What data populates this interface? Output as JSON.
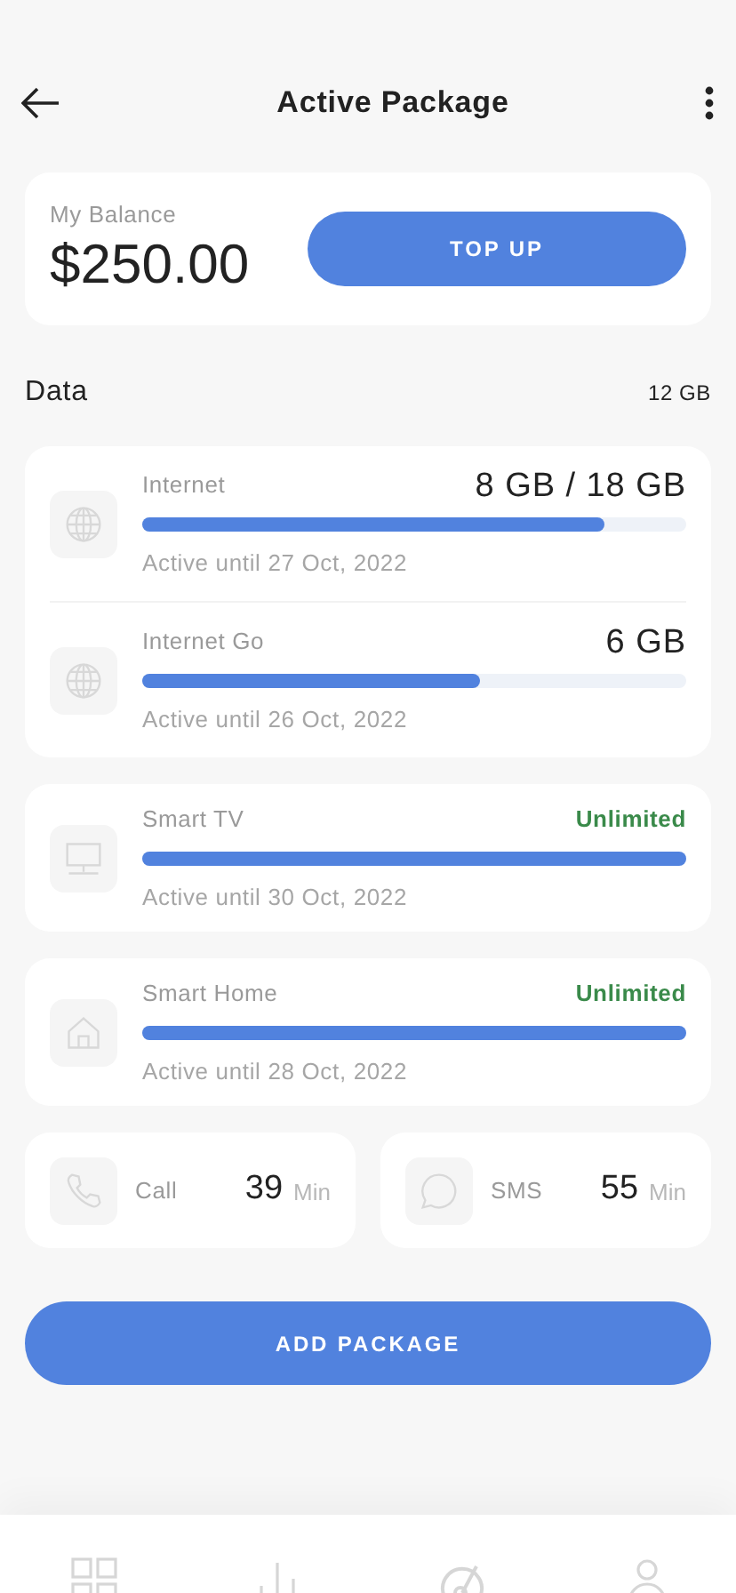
{
  "header": {
    "title": "Active Package"
  },
  "balance": {
    "label": "My Balance",
    "amount": "$250.00",
    "button": "TOP UP"
  },
  "data_section": {
    "title": "Data",
    "total": "12 GB"
  },
  "data_cards": [
    {
      "items": [
        {
          "kind": "internet",
          "name": "Internet",
          "amount": "8 GB / 18 GB",
          "unlimited": false,
          "level": 0.85,
          "expiry": "Active until 27 Oct, 2022"
        },
        {
          "kind": "internet",
          "name": "Internet Go",
          "amount": "6 GB",
          "unlimited": false,
          "level": 0.62,
          "expiry": "Active until 26 Oct, 2022"
        }
      ]
    },
    {
      "items": [
        {
          "kind": "tv",
          "name": "Smart TV",
          "amount": "Unlimited",
          "unlimited": true,
          "level": 1,
          "expiry": "Active until 30 Oct, 2022"
        }
      ]
    },
    {
      "items": [
        {
          "kind": "home",
          "name": "Smart Home",
          "amount": "Unlimited",
          "unlimited": true,
          "level": 1,
          "expiry": "Active until 28 Oct, 2022"
        }
      ]
    }
  ],
  "usage": [
    {
      "kind": "call",
      "label": "Call",
      "value": "39",
      "unit": "Min"
    },
    {
      "kind": "sms",
      "label": "SMS",
      "value": "55",
      "unit": "Min"
    }
  ],
  "add_button": "ADD PACKAGE"
}
